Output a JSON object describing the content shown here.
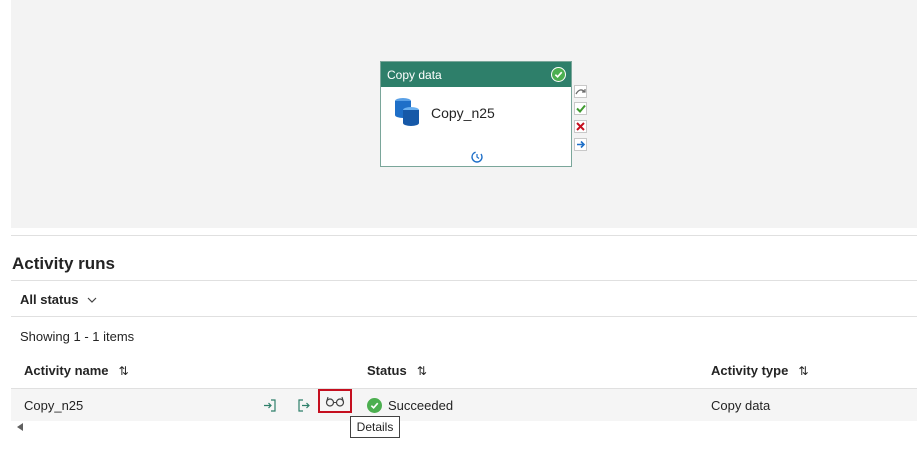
{
  "pipeline_canvas": {
    "node": {
      "type_label": "Copy data",
      "name": "Copy_n25",
      "status_icon": "success-check-icon"
    },
    "ports": [
      "skip-port-icon",
      "success-port-icon",
      "fail-port-icon",
      "completion-port-icon"
    ]
  },
  "activity_runs": {
    "title": "Activity runs",
    "filter_label": "All status",
    "showing_text": "Showing 1 - 1 items",
    "columns": {
      "name": "Activity name",
      "status": "Status",
      "type": "Activity type"
    },
    "rows": [
      {
        "name": "Copy_n25",
        "status": "Succeeded",
        "type": "Copy data"
      }
    ],
    "tooltip": "Details"
  },
  "colors": {
    "node_header": "#2e7f6a",
    "success": "#4caf50",
    "highlight": "#c50f1f"
  }
}
